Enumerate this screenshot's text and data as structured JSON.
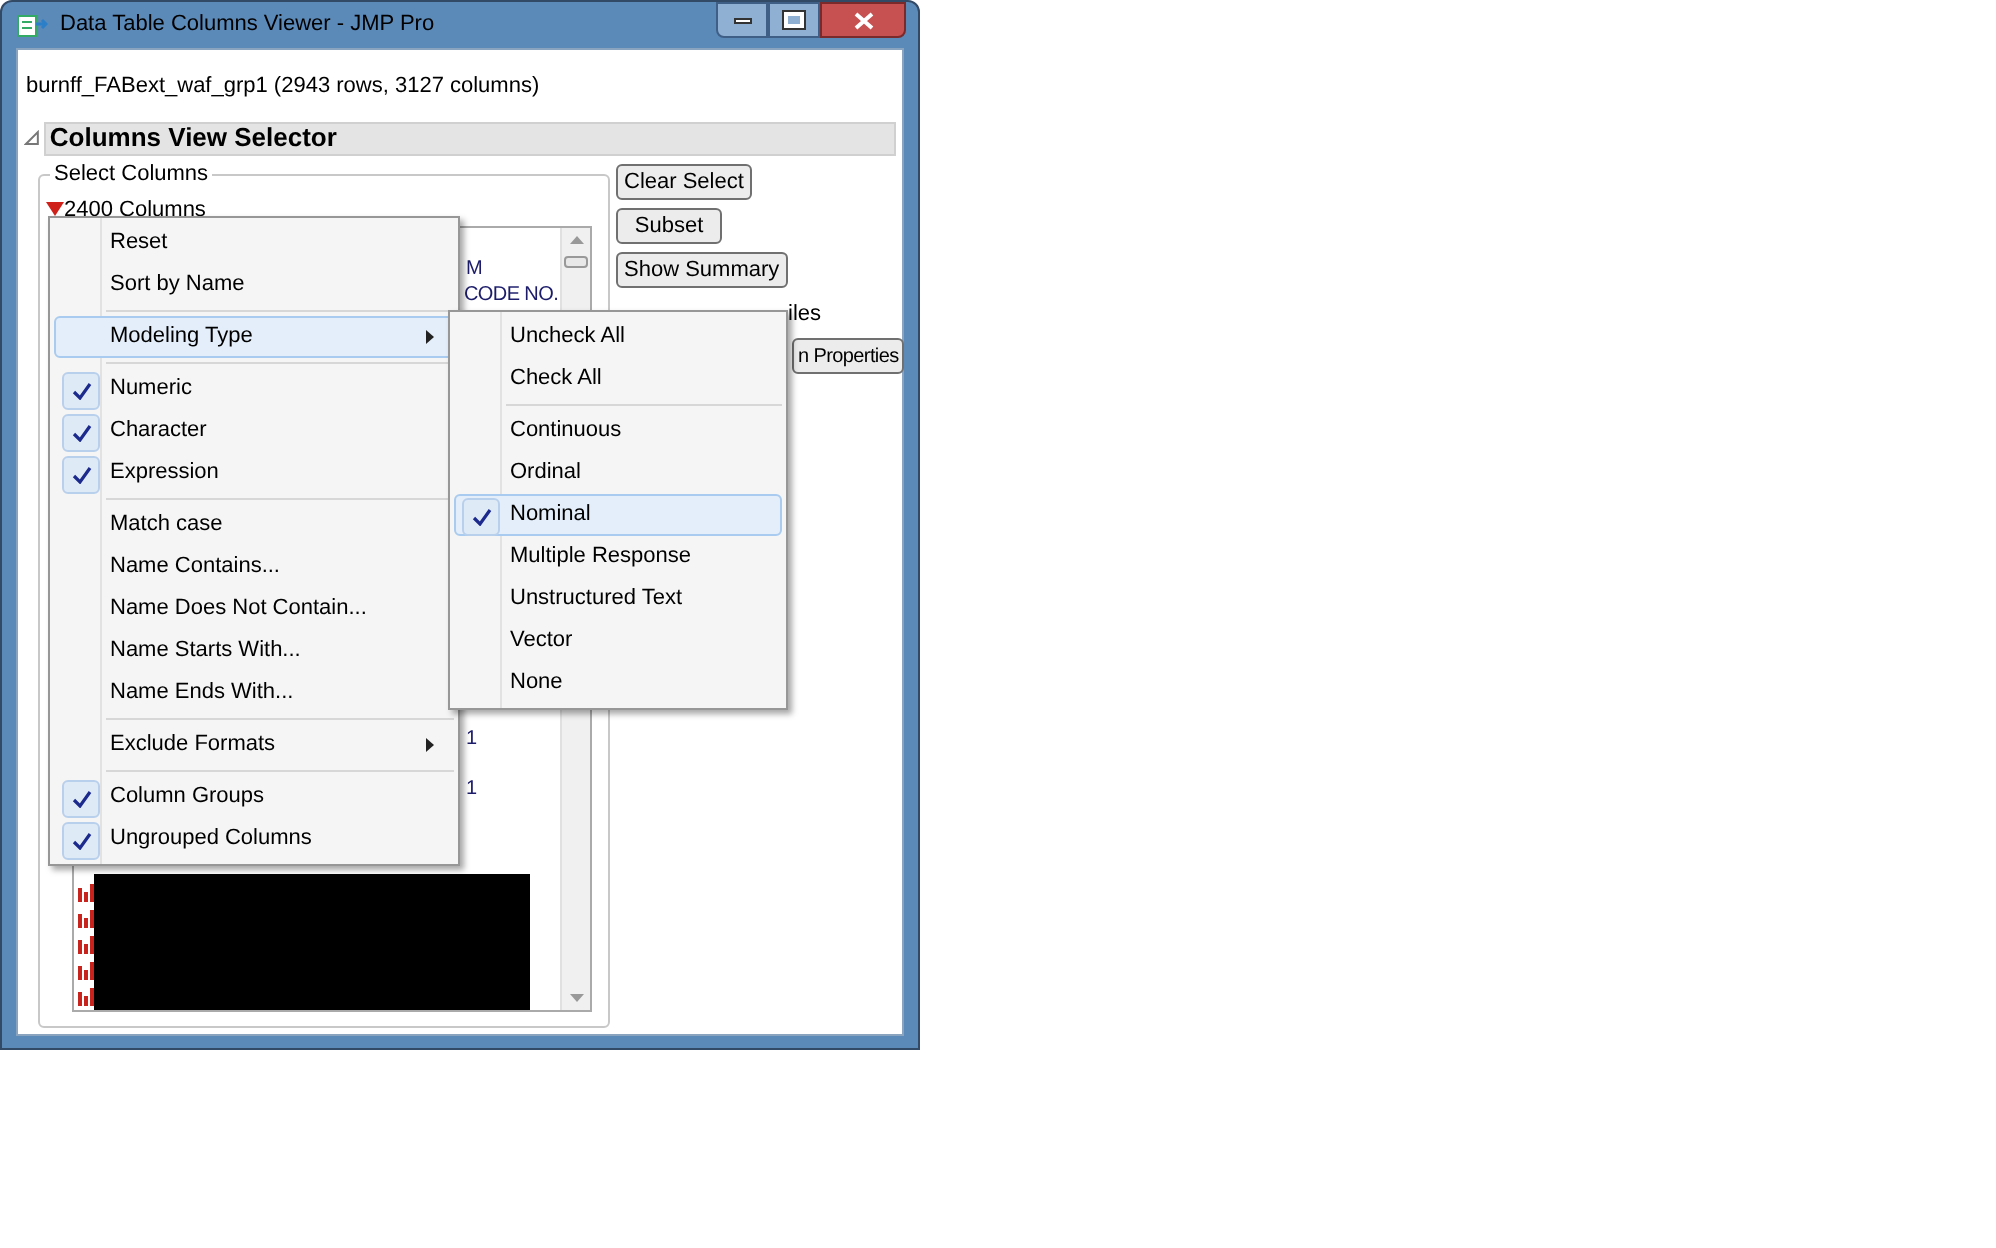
{
  "window": {
    "title": "Data Table Columns Viewer - JMP Pro"
  },
  "dataset_label": "burnff_FABext_waf_grp1 (2943 rows, 3127 columns)",
  "outline": {
    "title": "Columns View Selector",
    "expanded": true
  },
  "group": {
    "title": "Select Columns"
  },
  "column_list": {
    "header": "2400 Columns",
    "fragments": [
      {
        "text": "M"
      },
      {
        "text": "CODE NO."
      },
      {
        "text": "1"
      },
      {
        "text": "1"
      }
    ]
  },
  "buttons": [
    {
      "label": "Clear Select"
    },
    {
      "label": "Subset"
    },
    {
      "label": "Show Summary"
    }
  ],
  "partial_checkbox": {
    "label": "iles"
  },
  "partial_button": {
    "label": "n Properties"
  },
  "menu": [
    {
      "kind": "item",
      "label": "Reset",
      "checked": false
    },
    {
      "kind": "item",
      "label": "Sort by Name",
      "checked": false
    },
    {
      "kind": "separator"
    },
    {
      "kind": "submenu",
      "label": "Modeling Type",
      "selected": true
    },
    {
      "kind": "separator"
    },
    {
      "kind": "item",
      "label": "Numeric",
      "checked": true
    },
    {
      "kind": "item",
      "label": "Character",
      "checked": true
    },
    {
      "kind": "item",
      "label": "Expression",
      "checked": true
    },
    {
      "kind": "separator"
    },
    {
      "kind": "item",
      "label": "Match case",
      "checked": false
    },
    {
      "kind": "item",
      "label": "Name Contains...",
      "checked": false
    },
    {
      "kind": "item",
      "label": "Name Does Not Contain...",
      "checked": false
    },
    {
      "kind": "item",
      "label": "Name Starts With...",
      "checked": false
    },
    {
      "kind": "item",
      "label": "Name Ends With...",
      "checked": false
    },
    {
      "kind": "separator"
    },
    {
      "kind": "submenu",
      "label": "Exclude Formats",
      "selected": false
    },
    {
      "kind": "separator"
    },
    {
      "kind": "item",
      "label": "Column Groups",
      "checked": true
    },
    {
      "kind": "item",
      "label": "Ungrouped Columns",
      "checked": true
    }
  ],
  "submenu": [
    {
      "kind": "item",
      "label": "Uncheck All",
      "checked": false,
      "selected": false
    },
    {
      "kind": "item",
      "label": "Check All",
      "checked": false,
      "selected": false
    },
    {
      "kind": "separator"
    },
    {
      "kind": "item",
      "label": "Continuous",
      "checked": false,
      "selected": false
    },
    {
      "kind": "item",
      "label": "Ordinal",
      "checked": false,
      "selected": false
    },
    {
      "kind": "item",
      "label": "Nominal",
      "checked": true,
      "selected": true
    },
    {
      "kind": "item",
      "label": "Multiple Response",
      "checked": false,
      "selected": false
    },
    {
      "kind": "item",
      "label": "Unstructured Text",
      "checked": false,
      "selected": false
    },
    {
      "kind": "item",
      "label": "Vector",
      "checked": false,
      "selected": false
    },
    {
      "kind": "item",
      "label": "None",
      "checked": false,
      "selected": false
    }
  ]
}
